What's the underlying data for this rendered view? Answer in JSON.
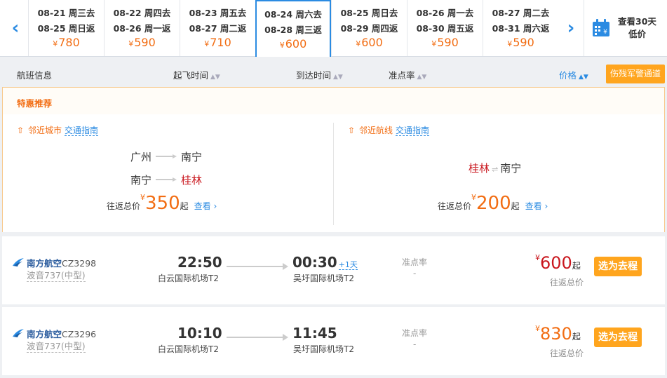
{
  "dates": [
    {
      "go": "08-21 周三去",
      "back": "08-25 周日返",
      "price": "780"
    },
    {
      "go": "08-22 周四去",
      "back": "08-26 周一返",
      "price": "590"
    },
    {
      "go": "08-23 周五去",
      "back": "08-27 周二返",
      "price": "710"
    },
    {
      "go": "08-24 周六去",
      "back": "08-28 周三返",
      "price": "600",
      "active": true
    },
    {
      "go": "08-25 周日去",
      "back": "08-29 周四返",
      "price": "600"
    },
    {
      "go": "08-26 周一去",
      "back": "08-30 周五返",
      "price": "590"
    },
    {
      "go": "08-27 周二去",
      "back": "08-31 周六返",
      "price": "590"
    }
  ],
  "currency": "¥",
  "calendar": {
    "line1": "查看30天",
    "line2": "低价"
  },
  "sort": {
    "flight_info": "航班信息",
    "depart_time": "起飞时间",
    "arrive_time": "到达时间",
    "punctuality": "准点率",
    "price": "价格",
    "disabled_channel": "伤残军警通道"
  },
  "recommend": {
    "title": "特惠推荐",
    "nearby_city": {
      "label": "邻近城市",
      "guide": "交通指南",
      "route1_from": "广州",
      "route1_to": "南宁",
      "route2_from": "南宁",
      "route2_to": "桂林",
      "price_label": "往返总价",
      "price": "350",
      "qi": "起",
      "look": "查看"
    },
    "nearby_route": {
      "label": "邻近航线",
      "guide": "交通指南",
      "route_from": "桂林",
      "route_to": "南宁",
      "price_label": "往返总价",
      "price": "200",
      "qi": "起",
      "look": "查看"
    }
  },
  "flights": [
    {
      "airline": "南方航空",
      "flight_no": "CZ3298",
      "plane": "波音737(中型)",
      "dep_time": "22:50",
      "dep_airport": "白云国际机场T2",
      "arr_time": "00:30",
      "plus_day": "+1天",
      "arr_airport": "吴圩国际机场T2",
      "punct_label": "准点率",
      "punct_value": "-",
      "price": "600",
      "qi": "起",
      "price_sub": "往返总价",
      "select": "选为去程"
    },
    {
      "airline": "南方航空",
      "flight_no": "CZ3296",
      "plane": "波音737(中型)",
      "dep_time": "10:10",
      "dep_airport": "白云国际机场T2",
      "arr_time": "11:45",
      "arr_airport": "吴圩国际机场T2",
      "punct_label": "准点率",
      "punct_value": "-",
      "price": "830",
      "qi": "起",
      "price_sub": "往返总价",
      "select": "选为去程"
    }
  ],
  "colors": {
    "accent": "#2b8be2",
    "orange": "#f26d13",
    "button": "#ffa51e",
    "red": "#c9161d"
  }
}
